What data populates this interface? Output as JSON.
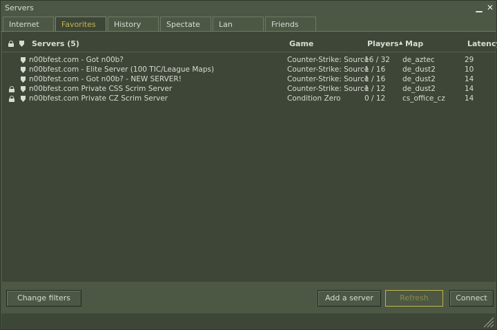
{
  "window": {
    "title": "Servers",
    "minimize_icon": "minimize-icon",
    "close_icon": "close-icon"
  },
  "tabs": [
    {
      "label": "Internet",
      "active": false
    },
    {
      "label": "Favorites",
      "active": true
    },
    {
      "label": "History",
      "active": false
    },
    {
      "label": "Spectate",
      "active": false
    },
    {
      "label": "Lan",
      "active": false
    },
    {
      "label": "Friends",
      "active": false
    }
  ],
  "list": {
    "headers": {
      "servers": "Servers (5)",
      "game": "Game",
      "players": "Players",
      "map": "Map",
      "latency": "Latency"
    },
    "sorted_by": "Players",
    "rows": [
      {
        "locked": false,
        "name": "n00bfest.com - Got n00b?",
        "game": "Counter-Strike: Source",
        "players": "16 / 32",
        "map": "de_aztec",
        "latency": "29"
      },
      {
        "locked": false,
        "name": "n00bfest.com - Elite Server (100 TIC/League Maps)",
        "game": "Counter-Strike: Source",
        "players": "1 / 16",
        "map": "de_dust2",
        "latency": "10"
      },
      {
        "locked": false,
        "name": "n00bfest.com - Got n00b? - NEW SERVER!",
        "game": "Counter-Strike: Source",
        "players": "1 / 16",
        "map": "de_dust2",
        "latency": "14"
      },
      {
        "locked": true,
        "name": "n00bfest.com Private CSS Scrim Server",
        "game": "Counter-Strike: Source",
        "players": "1 / 12",
        "map": "de_dust2",
        "latency": "14"
      },
      {
        "locked": true,
        "name": "n00bfest.com Private CZ Scrim Server",
        "game": "Condition Zero",
        "players": "0 / 12",
        "map": "cs_office_cz",
        "latency": "14"
      }
    ]
  },
  "footer": {
    "change_filters": "Change filters",
    "add_server": "Add a server",
    "refresh": "Refresh",
    "connect": "Connect"
  },
  "colors": {
    "accent": "#c4b550",
    "background": "#4c5844",
    "panel": "#3e4637",
    "text": "#d8dcd4"
  }
}
